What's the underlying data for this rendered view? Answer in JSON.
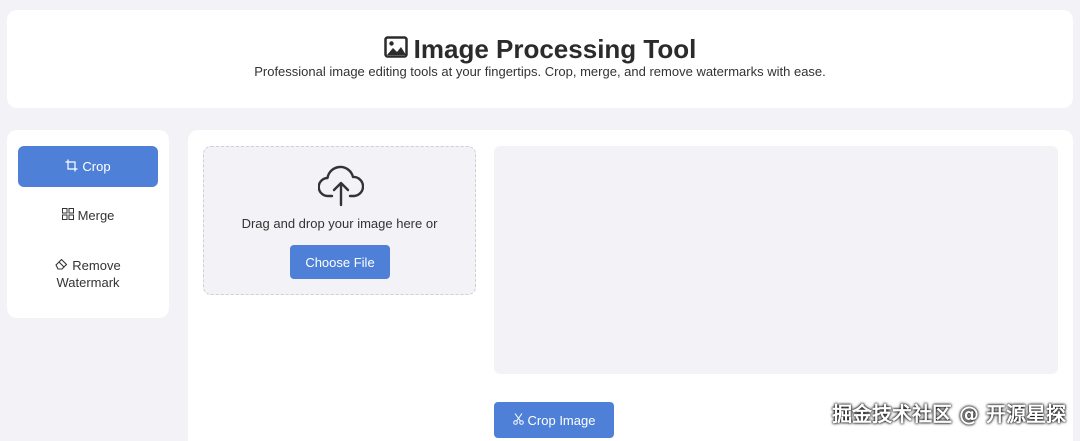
{
  "header": {
    "title": "Image Processing Tool",
    "subtitle": "Professional image editing tools at your fingertips. Crop, merge, and remove watermarks with ease.",
    "icon": "image-icon"
  },
  "sidebar": {
    "items": [
      {
        "label": "Crop",
        "icon": "crop-icon",
        "active": true
      },
      {
        "label": "Merge",
        "icon": "grid-icon",
        "active": false
      },
      {
        "label_line1": "Remove",
        "label_line2": "Watermark",
        "icon": "eraser-icon",
        "active": false
      }
    ]
  },
  "upload": {
    "icon": "cloud-upload-icon",
    "text": "Drag and drop your image here or",
    "button_label": "Choose File"
  },
  "actions": {
    "crop_button_label": "Crop Image",
    "crop_button_icon": "scissors-icon"
  },
  "watermark": {
    "text": "掘金技术社区 @ 开源星探"
  },
  "colors": {
    "accent": "#4e80d8",
    "background": "#f3f3f7",
    "panel": "#ffffff"
  }
}
